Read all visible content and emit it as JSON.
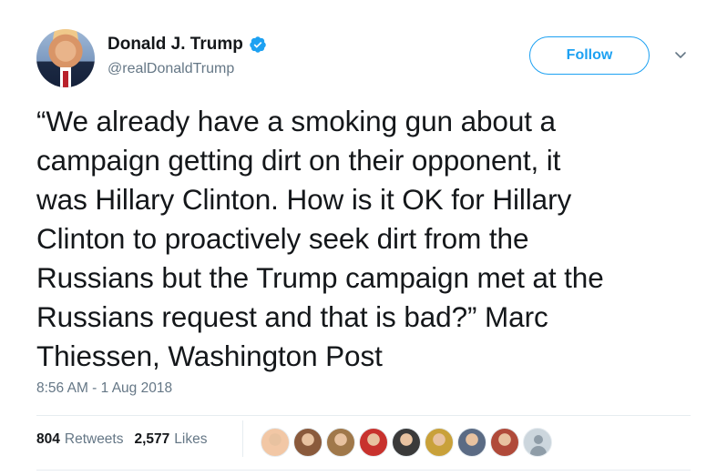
{
  "user": {
    "display_name": "Donald J. Trump",
    "handle": "@realDonaldTrump",
    "verified": true,
    "avatar_icon": "profile-photo"
  },
  "actions": {
    "follow_label": "Follow",
    "more_icon": "chevron-down-icon"
  },
  "tweet": {
    "lines": [
      "“We already have a smoking gun about a",
      "campaign getting dirt on their opponent, it",
      "was Hillary Clinton. How is it OK for Hillary",
      "Clinton to proactively seek dirt from the",
      "Russians but the Trump campaign met at the",
      "Russians request and that is bad?” Marc",
      "Thiessen, Washington Post"
    ],
    "timestamp": "8:56 AM - 1 Aug 2018"
  },
  "stats": {
    "retweets_count": "804",
    "retweets_label": "Retweets",
    "likes_count": "2,577",
    "likes_label": "Likes"
  },
  "likers": [
    {
      "icon": "hotdog-avatar",
      "color": "#f2c7a5"
    },
    {
      "icon": "crowd-avatar",
      "color": "#8a5a3c"
    },
    {
      "icon": "group-photo-avatar",
      "color": "#a0784a"
    },
    {
      "icon": "pills-avatar",
      "color": "#c8322d"
    },
    {
      "icon": "sunglasses-avatar",
      "color": "#3a3a3a"
    },
    {
      "icon": "figure-avatar",
      "color": "#c9a13a"
    },
    {
      "icon": "rally-avatar",
      "color": "#5b6b84"
    },
    {
      "icon": "portrait-avatar",
      "color": "#b04a3a"
    },
    {
      "icon": "default-avatar",
      "color": "#ccd6dd"
    }
  ],
  "colors": {
    "accent": "#1da1f2",
    "text": "#14171a",
    "secondary": "#657786",
    "divider": "#e6ecf0"
  }
}
